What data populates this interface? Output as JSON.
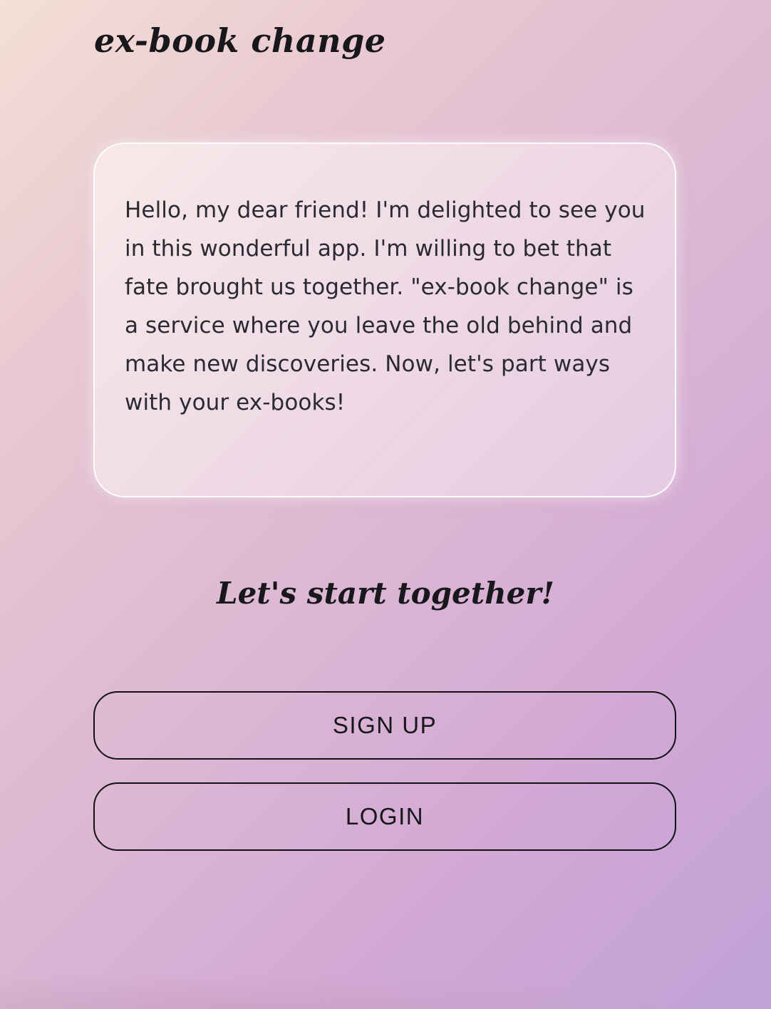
{
  "app": {
    "brand": "ex-book change"
  },
  "intro": {
    "text": "Hello, my dear friend! I'm delighted to see you in this wonderful app. I'm willing to bet that fate brought us together. \"ex-book change\" is a service where you leave the old behind and make new discoveries. Now, let's part ways with your ex-books!"
  },
  "cta": {
    "heading": "Let's start together!",
    "signup_label": "SIGN UP",
    "login_label": "LOGIN"
  },
  "colors": {
    "gradient_start": "#f4e0d6",
    "gradient_end": "#bfa2d6",
    "text": "#17171c",
    "button_border": "#111116"
  }
}
